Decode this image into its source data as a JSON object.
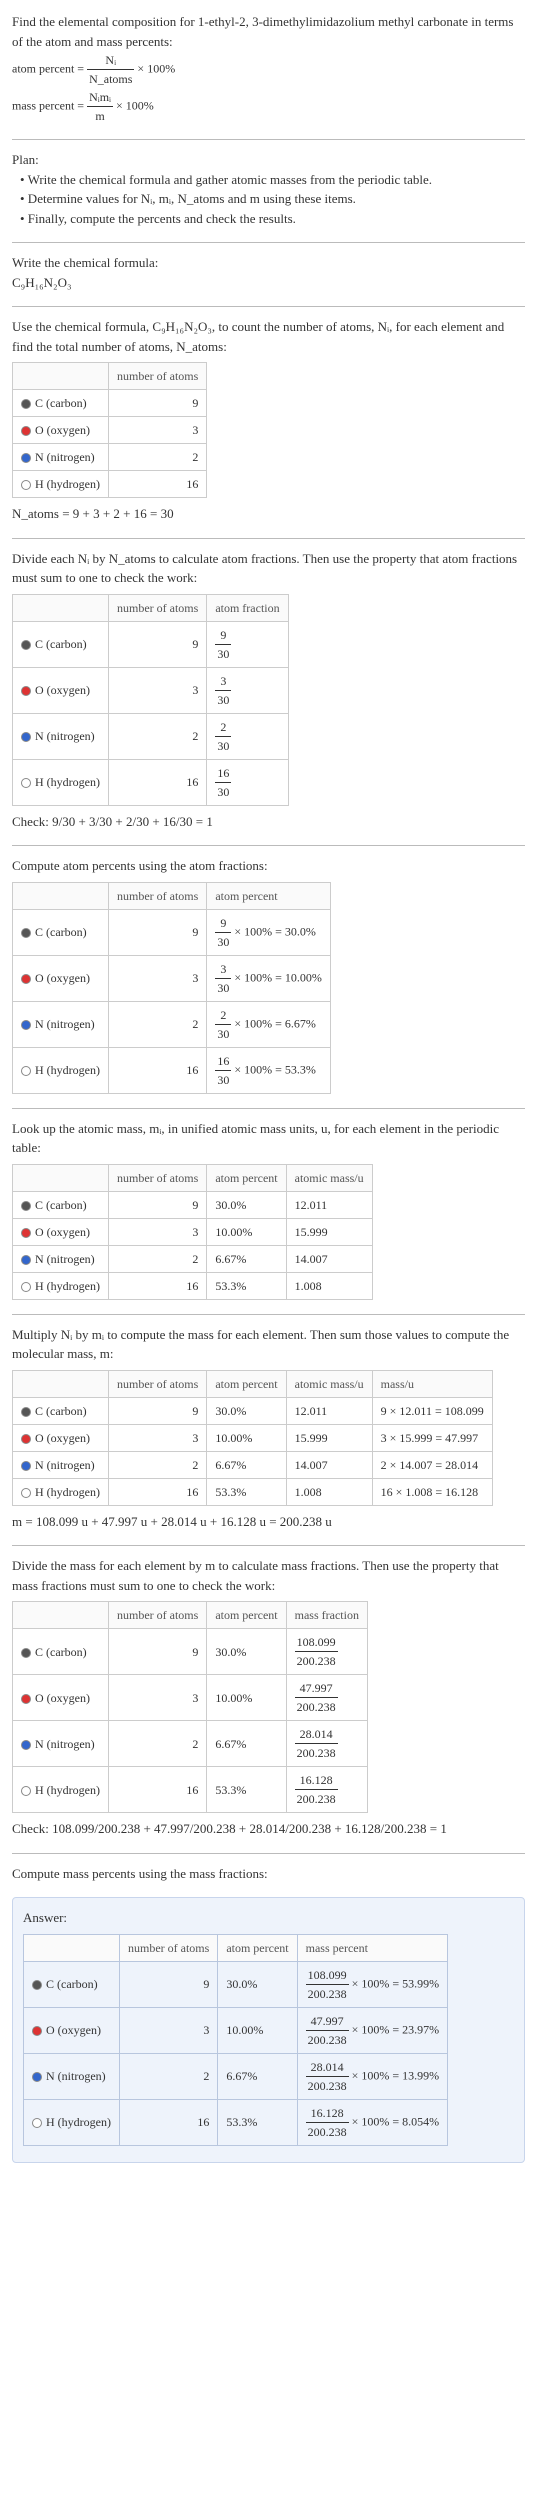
{
  "intro": {
    "prompt": "Find the elemental composition for 1-ethyl-2, 3-dimethylimidazolium methyl carbonate in terms of the atom and mass percents:",
    "atom_percent_label": "atom percent =",
    "atom_percent_rhs": "× 100%",
    "mass_percent_label": "mass percent =",
    "mass_percent_rhs": "× 100%",
    "frac1_num": "Nᵢ",
    "frac1_den": "N_atoms",
    "frac2_num": "Nᵢmᵢ",
    "frac2_den": "m"
  },
  "plan": {
    "heading": "Plan:",
    "b1": "• Write the chemical formula and gather atomic masses from the periodic table.",
    "b2": "• Determine values for Nᵢ, mᵢ, N_atoms and m using these items.",
    "b3": "• Finally, compute the percents and check the results."
  },
  "step1": {
    "heading": "Write the chemical formula:",
    "formula": "C₉H₁₆N₂O₃"
  },
  "step2": {
    "text": "Use the chemical formula, C₉H₁₆N₂O₃, to count the number of atoms, Nᵢ, for each element and find the total number of atoms, N_atoms:",
    "col_atoms": "number of atoms",
    "rows": [
      {
        "name": "C (carbon)",
        "color": "#555",
        "n": "9"
      },
      {
        "name": "O (oxygen)",
        "color": "#d33",
        "n": "3"
      },
      {
        "name": "N (nitrogen)",
        "color": "#36c",
        "n": "2"
      },
      {
        "name": "H (hydrogen)",
        "color": "#fff",
        "n": "16"
      }
    ],
    "sum": "N_atoms = 9 + 3 + 2 + 16 = 30"
  },
  "step3": {
    "text": "Divide each Nᵢ by N_atoms to calculate atom fractions. Then use the property that atom fractions must sum to one to check the work:",
    "col_atoms": "number of atoms",
    "col_frac": "atom fraction",
    "rows": [
      {
        "name": "C (carbon)",
        "color": "#555",
        "n": "9",
        "fnum": "9",
        "fden": "30"
      },
      {
        "name": "O (oxygen)",
        "color": "#d33",
        "n": "3",
        "fnum": "3",
        "fden": "30"
      },
      {
        "name": "N (nitrogen)",
        "color": "#36c",
        "n": "2",
        "fnum": "2",
        "fden": "30"
      },
      {
        "name": "H (hydrogen)",
        "color": "#fff",
        "n": "16",
        "fnum": "16",
        "fden": "30"
      }
    ],
    "check_label": "Check: ",
    "check_expr": "9/30 + 3/30 + 2/30 + 16/30 = 1"
  },
  "step4": {
    "text": "Compute atom percents using the atom fractions:",
    "col_atoms": "number of atoms",
    "col_pct": "atom percent",
    "rows": [
      {
        "name": "C (carbon)",
        "color": "#555",
        "n": "9",
        "fnum": "9",
        "fden": "30",
        "pct": "× 100% = 30.0%"
      },
      {
        "name": "O (oxygen)",
        "color": "#d33",
        "n": "3",
        "fnum": "3",
        "fden": "30",
        "pct": "× 100% = 10.00%"
      },
      {
        "name": "N (nitrogen)",
        "color": "#36c",
        "n": "2",
        "fnum": "2",
        "fden": "30",
        "pct": "× 100% = 6.67%"
      },
      {
        "name": "H (hydrogen)",
        "color": "#fff",
        "n": "16",
        "fnum": "16",
        "fden": "30",
        "pct": "× 100% = 53.3%"
      }
    ]
  },
  "step5": {
    "text": "Look up the atomic mass, mᵢ, in unified atomic mass units, u, for each element in the periodic table:",
    "col_atoms": "number of atoms",
    "col_pct": "atom percent",
    "col_mass": "atomic mass/u",
    "rows": [
      {
        "name": "C (carbon)",
        "color": "#555",
        "n": "9",
        "pct": "30.0%",
        "mass": "12.011"
      },
      {
        "name": "O (oxygen)",
        "color": "#d33",
        "n": "3",
        "pct": "10.00%",
        "mass": "15.999"
      },
      {
        "name": "N (nitrogen)",
        "color": "#36c",
        "n": "2",
        "pct": "6.67%",
        "mass": "14.007"
      },
      {
        "name": "H (hydrogen)",
        "color": "#fff",
        "n": "16",
        "pct": "53.3%",
        "mass": "1.008"
      }
    ]
  },
  "step6": {
    "text": "Multiply Nᵢ by mᵢ to compute the mass for each element. Then sum those values to compute the molecular mass, m:",
    "col_atoms": "number of atoms",
    "col_pct": "atom percent",
    "col_mass": "atomic mass/u",
    "col_total": "mass/u",
    "rows": [
      {
        "name": "C (carbon)",
        "color": "#555",
        "n": "9",
        "pct": "30.0%",
        "mass": "12.011",
        "calc": "9 × 12.011 = 108.099"
      },
      {
        "name": "O (oxygen)",
        "color": "#d33",
        "n": "3",
        "pct": "10.00%",
        "mass": "15.999",
        "calc": "3 × 15.999 = 47.997"
      },
      {
        "name": "N (nitrogen)",
        "color": "#36c",
        "n": "2",
        "pct": "6.67%",
        "mass": "14.007",
        "calc": "2 × 14.007 = 28.014"
      },
      {
        "name": "H (hydrogen)",
        "color": "#fff",
        "n": "16",
        "pct": "53.3%",
        "mass": "1.008",
        "calc": "16 × 1.008 = 16.128"
      }
    ],
    "sum": "m = 108.099 u + 47.997 u + 28.014 u + 16.128 u = 200.238 u"
  },
  "step7": {
    "text": "Divide the mass for each element by m to calculate mass fractions. Then use the property that mass fractions must sum to one to check the work:",
    "col_atoms": "number of atoms",
    "col_pct": "atom percent",
    "col_mfrac": "mass fraction",
    "rows": [
      {
        "name": "C (carbon)",
        "color": "#555",
        "n": "9",
        "pct": "30.0%",
        "fnum": "108.099",
        "fden": "200.238"
      },
      {
        "name": "O (oxygen)",
        "color": "#d33",
        "n": "3",
        "pct": "10.00%",
        "fnum": "47.997",
        "fden": "200.238"
      },
      {
        "name": "N (nitrogen)",
        "color": "#36c",
        "n": "2",
        "pct": "6.67%",
        "fnum": "28.014",
        "fden": "200.238"
      },
      {
        "name": "H (hydrogen)",
        "color": "#fff",
        "n": "16",
        "pct": "53.3%",
        "fnum": "16.128",
        "fden": "200.238"
      }
    ],
    "check_label": "Check: ",
    "check_expr": "108.099/200.238 + 47.997/200.238 + 28.014/200.238 + 16.128/200.238 = 1"
  },
  "step8": {
    "text": "Compute mass percents using the mass fractions:"
  },
  "answer": {
    "heading": "Answer:",
    "col_atoms": "number of atoms",
    "col_pct": "atom percent",
    "col_mpct": "mass percent",
    "rows": [
      {
        "name": "C (carbon)",
        "color": "#555",
        "n": "9",
        "pct": "30.0%",
        "fnum": "108.099",
        "fden": "200.238",
        "mpct": "× 100% = 53.99%"
      },
      {
        "name": "O (oxygen)",
        "color": "#d33",
        "n": "3",
        "pct": "10.00%",
        "fnum": "47.997",
        "fden": "200.238",
        "mpct": "× 100% = 23.97%"
      },
      {
        "name": "N (nitrogen)",
        "color": "#36c",
        "n": "2",
        "pct": "6.67%",
        "fnum": "28.014",
        "fden": "200.238",
        "mpct": "× 100% = 13.99%"
      },
      {
        "name": "H (hydrogen)",
        "color": "#fff",
        "n": "16",
        "pct": "53.3%",
        "fnum": "16.128",
        "fden": "200.238",
        "mpct": "× 100% = 8.054%"
      }
    ]
  },
  "chart_data": {
    "type": "table",
    "title": "Elemental composition of C9H16N2O3",
    "columns": [
      "element",
      "number_of_atoms",
      "atom_percent",
      "atomic_mass_u",
      "mass_u",
      "mass_percent"
    ],
    "rows": [
      [
        "C (carbon)",
        9,
        30.0,
        12.011,
        108.099,
        53.99
      ],
      [
        "O (oxygen)",
        3,
        10.0,
        15.999,
        47.997,
        23.97
      ],
      [
        "N (nitrogen)",
        2,
        6.67,
        14.007,
        28.014,
        13.99
      ],
      [
        "H (hydrogen)",
        16,
        53.3,
        1.008,
        16.128,
        8.054
      ]
    ],
    "totals": {
      "N_atoms": 30,
      "m_u": 200.238
    }
  }
}
